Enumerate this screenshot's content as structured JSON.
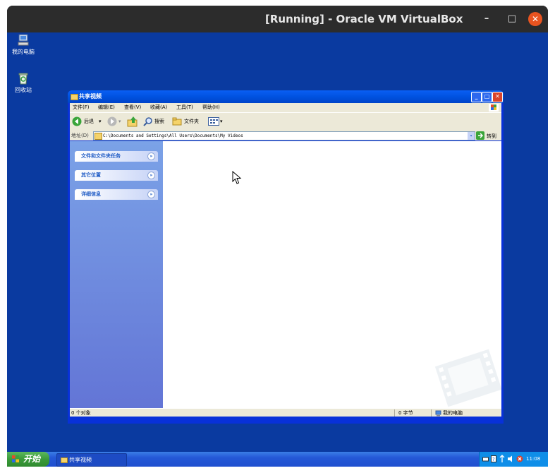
{
  "vbox": {
    "title": "[Running] - Oracle VM VirtualBox",
    "minimize": "–",
    "maximize": "□",
    "close": "✕"
  },
  "desktop": {
    "icons": [
      {
        "label": "我的电脑",
        "icon": "computer-icon"
      },
      {
        "label": "回收站",
        "icon": "recycle-bin-icon"
      }
    ]
  },
  "window": {
    "title": "共享视频",
    "menu": [
      "文件(F)",
      "编辑(E)",
      "查看(V)",
      "收藏(A)",
      "工具(T)",
      "帮助(H)"
    ],
    "toolbar": {
      "back": "后退",
      "search": "搜索",
      "folders": "文件夹"
    },
    "address": {
      "label": "地址(D)",
      "value": "C:\\Documents and Settings\\All Users\\Documents\\My Videos",
      "go": "转到"
    },
    "panels": [
      "文件和文件夹任务",
      "其它位置",
      "详细信息"
    ],
    "status": {
      "objects": "0 个对象",
      "size": "0 字节",
      "location": "我的电脑"
    }
  },
  "taskbar": {
    "start": "开始",
    "task": "共享视频",
    "clock": "11:08"
  },
  "colors": {
    "desktop": "#0a3aa0",
    "xp_blue": "#0831d9",
    "ubuntu_orange": "#e95420"
  }
}
